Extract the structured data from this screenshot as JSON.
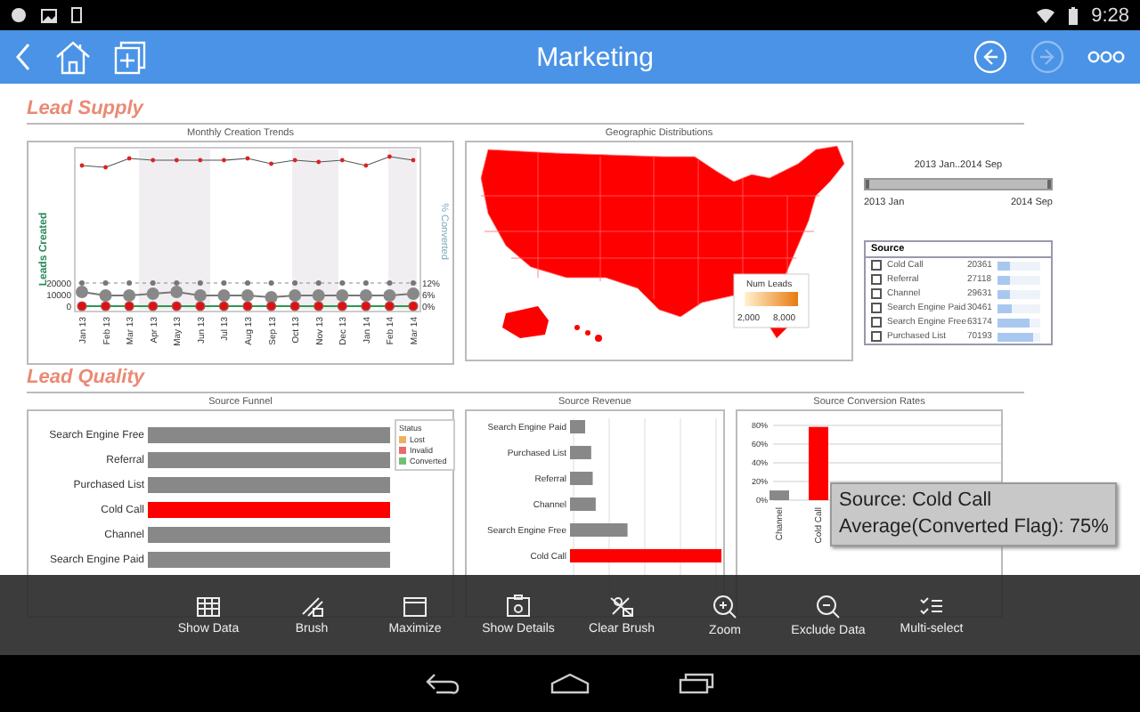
{
  "status_bar": {
    "time": "9:28"
  },
  "app_bar": {
    "title": "Marketing",
    "nav_buttons": [
      {
        "kind": "back",
        "disabled": false
      },
      {
        "kind": "forward",
        "disabled": true
      }
    ]
  },
  "lead_supply": {
    "heading": "Lead Supply",
    "trend_chart": {
      "title": "Monthly Creation Trends",
      "y_axis_label": "Leads Created",
      "y2_axis_label": "% Converted",
      "yticks": [
        "20000",
        "10000",
        "0"
      ],
      "y2ticks": [
        "12%",
        "6%",
        "0%"
      ],
      "months": [
        "Jan 13",
        "Feb 13",
        "Mar 13",
        "Apr 13",
        "May 13",
        "Jun 13",
        "Jul 13",
        "Aug 13",
        "Sep 13",
        "Oct 13",
        "Nov 13",
        "Dec 13",
        "Jan 14",
        "Feb 14",
        "Mar 14"
      ]
    },
    "map": {
      "title": "Geographic Distributions",
      "legend_title": "Num Leads",
      "legend_min": "2,000",
      "legend_max": "8,000"
    },
    "date_range": {
      "label": "2013 Jan..2014 Sep",
      "start": "2013 Jan",
      "end": "2014 Sep",
      "level": 1
    },
    "source_list": {
      "header": "Source",
      "rows": [
        {
          "name": "Cold Call",
          "count": "20361",
          "level": 0.3,
          "checked": false
        },
        {
          "name": "Referral",
          "count": "27118",
          "level": 0.3,
          "checked": false
        },
        {
          "name": "Channel",
          "count": "29631",
          "level": 0.3,
          "checked": false
        },
        {
          "name": "Search Engine Paid",
          "count": "30461",
          "level": 0.32,
          "checked": false
        },
        {
          "name": "Search Engine Free",
          "count": "63174",
          "level": 0.75,
          "checked": false
        },
        {
          "name": "Purchased List",
          "count": "70193",
          "level": 0.82,
          "checked": false
        }
      ]
    }
  },
  "lead_quality": {
    "heading": "Lead Quality",
    "funnel": {
      "title": "Source Funnel",
      "categories": [
        {
          "label": "Search Engine Free",
          "selected": false
        },
        {
          "label": "Referral",
          "selected": false
        },
        {
          "label": "Purchased List",
          "selected": false
        },
        {
          "label": "Cold Call",
          "selected": true
        },
        {
          "label": "Channel",
          "selected": false
        },
        {
          "label": "Search Engine Paid",
          "selected": false
        }
      ],
      "legend": {
        "title": "Status",
        "items": [
          {
            "label": "Lost",
            "color": "#f0b060"
          },
          {
            "label": "Invalid",
            "color": "#e86a6a"
          },
          {
            "label": "Converted",
            "color": "#72c072"
          }
        ]
      }
    },
    "revenue": {
      "title": "Source Revenue",
      "categories": [
        {
          "label": "Search Engine Paid",
          "selected": false
        },
        {
          "label": "Purchased List",
          "selected": false
        },
        {
          "label": "Referral",
          "selected": false
        },
        {
          "label": "Channel",
          "selected": false
        },
        {
          "label": "Search Engine Free",
          "selected": false
        },
        {
          "label": "Cold Call",
          "selected": true
        }
      ]
    },
    "conversion": {
      "title": "Source Conversion Rates",
      "yticks": [
        "80%",
        "60%",
        "40%",
        "20%",
        "0%"
      ],
      "categories": [
        {
          "label": "Channel",
          "selected": false
        },
        {
          "label": "Cold Call",
          "selected": true
        }
      ]
    }
  },
  "tooltip": {
    "lines": [
      "Source: Cold Call",
      "Average(Converted Flag): 75%"
    ]
  },
  "toolbar": [
    {
      "label": "Show Data",
      "kind": "show-data"
    },
    {
      "label": "Brush",
      "kind": "brush"
    },
    {
      "label": "Maximize",
      "kind": "maximize"
    },
    {
      "label": "Show Details",
      "kind": "show-details"
    },
    {
      "label": "Clear Brush",
      "kind": "clear-brush"
    },
    {
      "label": "Zoom",
      "kind": "zoom"
    },
    {
      "label": "Exclude Data",
      "kind": "exclude-data"
    },
    {
      "label": "Multi-select",
      "kind": "multi-select"
    }
  ]
}
